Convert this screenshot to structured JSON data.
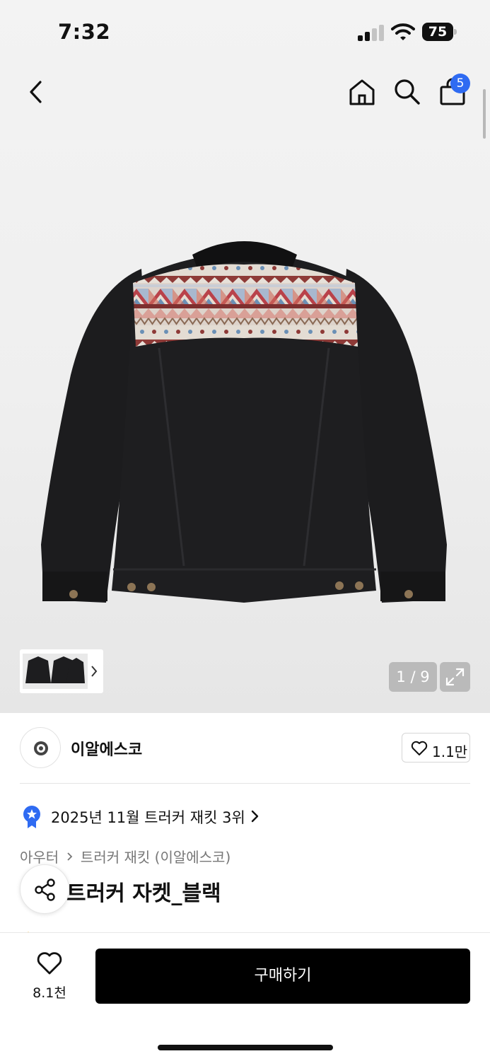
{
  "status_bar": {
    "time": "7:32",
    "battery": "75"
  },
  "header": {
    "cart_count": "5"
  },
  "gallery": {
    "counter": "1 / 9"
  },
  "brand": {
    "name": "이알에스코",
    "like_count": "1.1만"
  },
  "ranking": {
    "text": "2025년 11월 트러커 재킷 3위"
  },
  "breadcrumb": {
    "items": [
      "아우터",
      "트러커 재킷 (이알에스코)"
    ]
  },
  "product": {
    "title": "트러커 자켓_블랙"
  },
  "bottom_bar": {
    "wish_count": "8.1천",
    "buy_label": "구매하기"
  },
  "colors": {
    "accent_blue": "#2f6bf2",
    "buy_button": "#000000"
  },
  "icons": [
    "back-arrow-icon",
    "home-icon",
    "search-icon",
    "bag-icon",
    "chevron-right-icon",
    "expand-icon",
    "heart-icon",
    "ranking-badge-icon",
    "share-icon"
  ]
}
